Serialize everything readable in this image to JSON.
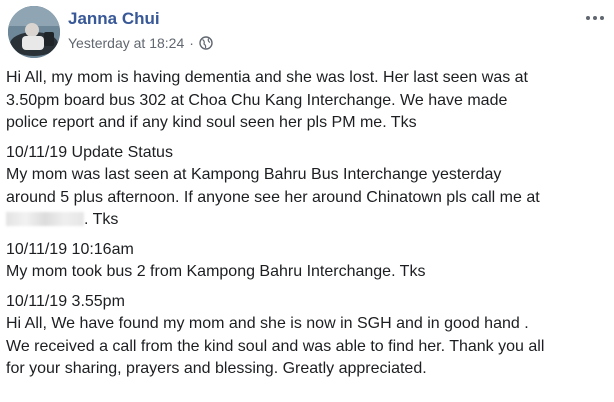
{
  "post": {
    "author": "Janna Chui",
    "timestamp": "Yesterday at 18:24",
    "separator": "·",
    "privacy_icon": "globe-icon",
    "menu_icon": "more-options-icon"
  },
  "paragraphs": [
    {
      "lines": [
        "Hi All, my mom is having dementia and she was lost. Her last seen was at",
        "3.50pm board bus 302 at Choa Chu Kang Interchange. We have made",
        "police report and if any kind soul seen her pls PM me. Tks"
      ]
    },
    {
      "lines": [
        "10/11/19 Update Status",
        "My mom was last seen at Kampong Bahru Bus Interchange yesterday",
        "around 5 plus afternoon. If anyone see her around Chinatown pls call me at"
      ],
      "redacted_line_suffix": ". Tks"
    },
    {
      "lines": [
        "10/11/19 10:16am",
        "My mom took bus 2 from Kampong Bahru Interchange. Tks"
      ]
    },
    {
      "lines": [
        "10/11/19 3.55pm",
        "Hi All, We have found my mom and she is now in SGH and in good hand .",
        "We received a call from the kind soul and was able to find her. Thank you all",
        "for your sharing, prayers and blessing. Greatly appreciated."
      ]
    }
  ],
  "colors": {
    "author_link": "#385898",
    "meta_text": "#616770",
    "body_text": "#1c1e21"
  }
}
